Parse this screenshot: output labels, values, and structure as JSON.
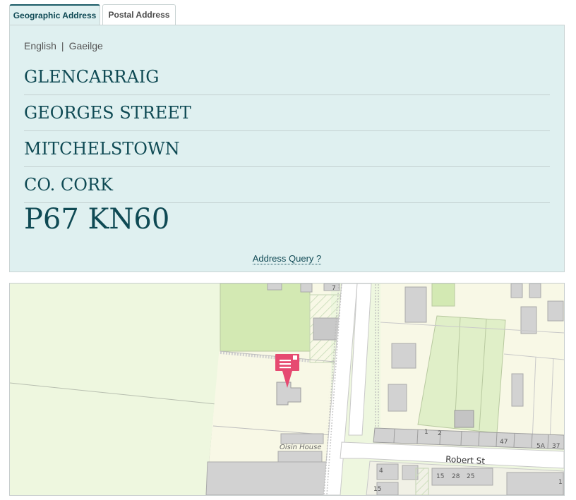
{
  "tabs": [
    {
      "label": "Geographic Address",
      "active": true
    },
    {
      "label": "Postal Address",
      "active": false
    }
  ],
  "language": {
    "english": "English",
    "separator": "|",
    "irish": "Gaeilge"
  },
  "address": {
    "line1": "GLENCARRAIG",
    "line2": "GEORGES STREET",
    "line3": "MITCHELSTOWN",
    "line4": "CO. CORK",
    "eircode": "P67 KN60"
  },
  "query_link": "Address Query ?",
  "map": {
    "labels": {
      "building": "Oisin House",
      "street": "Robert St",
      "n7": "7",
      "n1": "1",
      "n2": "2",
      "n47": "47",
      "n5a": "5A",
      "n37": "37",
      "n4": "4",
      "n15a": "15",
      "n28": "28",
      "n25": "25",
      "n15b": "15",
      "n1b": "1"
    },
    "colors": {
      "field": "#eef7df",
      "green": "#d3e9b3",
      "building": "#d2d2d2",
      "road": "#ffffff",
      "marker": "#e64a71"
    },
    "marker_icon": "map-pin-icon"
  }
}
